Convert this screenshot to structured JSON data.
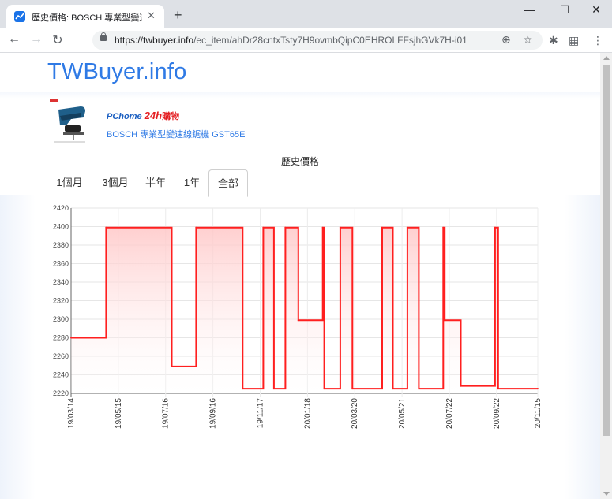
{
  "browser": {
    "tab_title": "歷史價格: BOSCH 專業型變速線鋸",
    "tab_close": "✕",
    "new_tab": "+",
    "url_host": "https://twbuyer.info",
    "url_path": "/ec_item/ahDr28cntxTsty7H9ovmbQipC0EHROLFFsjhGVk7H-i01",
    "window_controls": [
      "—",
      "☐",
      "✕"
    ]
  },
  "page": {
    "brand": "TWBuyer.info",
    "store_logo_pc": "PChome",
    "store_logo_24": "24h",
    "store_logo_shop": "購物",
    "product_name": "BOSCH 專業型變速線鋸機 GST65E",
    "section_title": "歷史價格",
    "period_tabs": [
      "1個月",
      "3個月",
      "半年",
      "1年",
      "全部"
    ],
    "active_tab": "全部"
  },
  "icons": {
    "back": "arrow-left-icon",
    "forward": "arrow-right-icon",
    "reload": "reload-icon",
    "lock": "lock-icon",
    "add": "add-circle-icon",
    "bookmark": "star-icon",
    "extensions": "puzzle-icon",
    "menu": "kebab-menu-icon"
  },
  "colors": {
    "brand": "#2f7ae5",
    "line": "#ff1f1f",
    "fill_top": "#ffc7c7",
    "store_red": "#e41d21"
  },
  "chart_data": {
    "type": "area",
    "x_unit": "date",
    "y_ticks": [
      2220,
      2240,
      2260,
      2280,
      2300,
      2320,
      2340,
      2360,
      2380,
      2400,
      2420
    ],
    "ylim": [
      2220,
      2420
    ],
    "x_ticks": [
      "19/03/14",
      "19/05/15",
      "19/07/16",
      "19/09/16",
      "19/11/17",
      "20/01/18",
      "20/03/20",
      "20/05/21",
      "20/07/22",
      "20/09/22",
      "20/11/15"
    ],
    "grid": true,
    "series": [
      {
        "step_points": [
          [
            "2019-03-14",
            2280
          ],
          [
            "2019-04-29",
            2399
          ],
          [
            "2019-07-24",
            2249
          ],
          [
            "2019-08-25",
            2399
          ],
          [
            "2019-10-25",
            2225
          ],
          [
            "2019-11-21",
            2399
          ],
          [
            "2019-12-05",
            2225
          ],
          [
            "2019-12-20",
            2399
          ],
          [
            "2020-01-06",
            2299
          ],
          [
            "2020-02-07",
            2399
          ],
          [
            "2020-02-09",
            2225
          ],
          [
            "2020-03-01",
            2399
          ],
          [
            "2020-03-17",
            2225
          ],
          [
            "2020-04-25",
            2399
          ],
          [
            "2020-05-09",
            2225
          ],
          [
            "2020-05-28",
            2399
          ],
          [
            "2020-06-12",
            2225
          ],
          [
            "2020-07-14",
            2399
          ],
          [
            "2020-07-16",
            2299
          ],
          [
            "2020-08-06",
            2228
          ],
          [
            "2020-09-20",
            2399
          ],
          [
            "2020-09-24",
            2225
          ],
          [
            "2020-11-15",
            2225
          ]
        ]
      }
    ]
  }
}
